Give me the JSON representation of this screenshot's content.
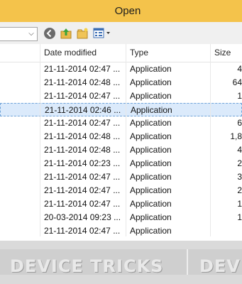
{
  "window": {
    "title": "Open"
  },
  "toolbar": {
    "location_value": "",
    "icons": [
      "back-icon",
      "up-folder-icon",
      "new-folder-icon",
      "view-menu-icon"
    ]
  },
  "columns": {
    "date_modified": "Date modified",
    "type": "Type",
    "size": "Size"
  },
  "rows": [
    {
      "date": "21-11-2014 02:47 ...",
      "type": "Application",
      "size": "4",
      "selected": false
    },
    {
      "date": "21-11-2014 02:48 ...",
      "type": "Application",
      "size": "64",
      "selected": false
    },
    {
      "date": "21-11-2014 02:47 ...",
      "type": "Application",
      "size": "1",
      "selected": false
    },
    {
      "date": "21-11-2014 02:46 ...",
      "type": "Application",
      "size": "",
      "selected": true
    },
    {
      "date": "21-11-2014 02:47 ...",
      "type": "Application",
      "size": "6",
      "selected": false
    },
    {
      "date": "21-11-2014 02:48 ...",
      "type": "Application",
      "size": "1,8",
      "selected": false
    },
    {
      "date": "21-11-2014 02:48 ...",
      "type": "Application",
      "size": "4",
      "selected": false
    },
    {
      "date": "21-11-2014 02:23 ...",
      "type": "Application",
      "size": "2",
      "selected": false
    },
    {
      "date": "21-11-2014 02:47 ...",
      "type": "Application",
      "size": "3",
      "selected": false
    },
    {
      "date": "21-11-2014 02:47 ...",
      "type": "Application",
      "size": "2",
      "selected": false
    },
    {
      "date": "21-11-2014 02:47 ...",
      "type": "Application",
      "size": "1",
      "selected": false
    },
    {
      "date": "20-03-2014 09:23 ...",
      "type": "Application",
      "size": "1",
      "selected": false
    },
    {
      "date": "21-11-2014 02:47 ...",
      "type": "Application",
      "size": "",
      "selected": false
    }
  ],
  "watermark": {
    "text": "DEVICE TRICKS",
    "text_2": "DEV"
  },
  "colors": {
    "titlebar": "#f4c34b",
    "selection": "#dbeafb"
  }
}
